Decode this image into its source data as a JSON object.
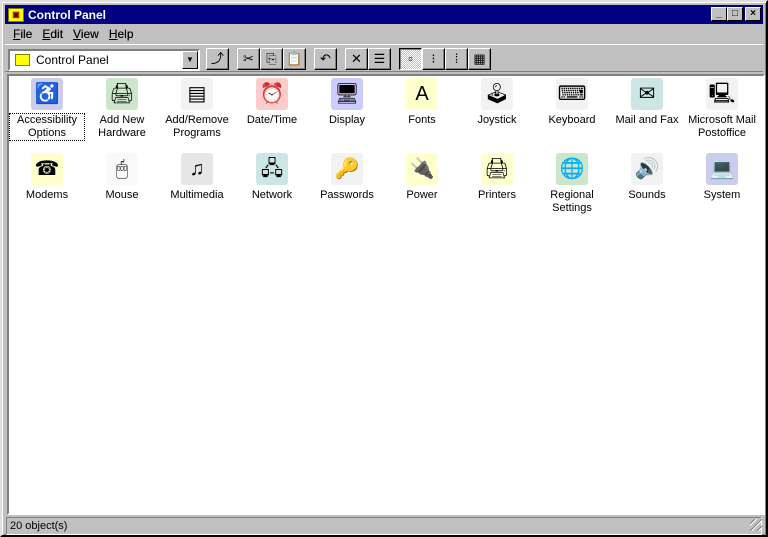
{
  "window": {
    "title": "Control Panel",
    "minimize": "_",
    "maximize": "□",
    "close": "×"
  },
  "menu": [
    {
      "label": "File",
      "key": "F",
      "rest": "ile"
    },
    {
      "label": "Edit",
      "key": "E",
      "rest": "dit"
    },
    {
      "label": "View",
      "key": "V",
      "rest": "iew"
    },
    {
      "label": "Help",
      "key": "H",
      "rest": "elp"
    }
  ],
  "address": {
    "value": "Control Panel",
    "dropdown": "▼"
  },
  "toolbar": {
    "up": "⤴",
    "cut": "✂",
    "copy": "⎘",
    "paste": "📋",
    "undo": "↶",
    "delete": "✕",
    "properties": "☰",
    "large_icons": "▫",
    "small_icons": "⁝",
    "list": "⁞",
    "details": "▦"
  },
  "items": [
    {
      "label": "Accessibility Options",
      "glyph": "♿",
      "color": "#0000a0"
    },
    {
      "label": "Add New Hardware",
      "glyph": "🖨",
      "color": "#008000"
    },
    {
      "label": "Add/Remove Programs",
      "glyph": "▤",
      "color": "#c0c0c0"
    },
    {
      "label": "Date/Time",
      "glyph": "⏰",
      "color": "#ff0000"
    },
    {
      "label": "Display",
      "glyph": "🖥",
      "color": "#0000ff"
    },
    {
      "label": "Fonts",
      "glyph": "A",
      "color": "#ffff00"
    },
    {
      "label": "Joystick",
      "glyph": "🕹",
      "color": "#c0c0c0"
    },
    {
      "label": "Keyboard",
      "glyph": "⌨",
      "color": "#c0c0c0"
    },
    {
      "label": "Mail and Fax",
      "glyph": "✉",
      "color": "#008080"
    },
    {
      "label": "Microsoft Mail Postoffice",
      "glyph": "🖳",
      "color": "#c0c0c0"
    },
    {
      "label": "Modems",
      "glyph": "☎",
      "color": "#ffff00"
    },
    {
      "label": "Mouse",
      "glyph": "🖱",
      "color": "#e0e0e0"
    },
    {
      "label": "Multimedia",
      "glyph": "♫",
      "color": "#808080"
    },
    {
      "label": "Network",
      "glyph": "🖧",
      "color": "#008080"
    },
    {
      "label": "Passwords",
      "glyph": "🔑",
      "color": "#c0c0c0"
    },
    {
      "label": "Power",
      "glyph": "🔌",
      "color": "#ffff00"
    },
    {
      "label": "Printers",
      "glyph": "🖨",
      "color": "#ffff00"
    },
    {
      "label": "Regional Settings",
      "glyph": "🌐",
      "color": "#008000"
    },
    {
      "label": "Sounds",
      "glyph": "🔊",
      "color": "#c0c0c0"
    },
    {
      "label": "System",
      "glyph": "💻",
      "color": "#0000a0"
    }
  ],
  "status": {
    "text": "20 object(s)"
  }
}
